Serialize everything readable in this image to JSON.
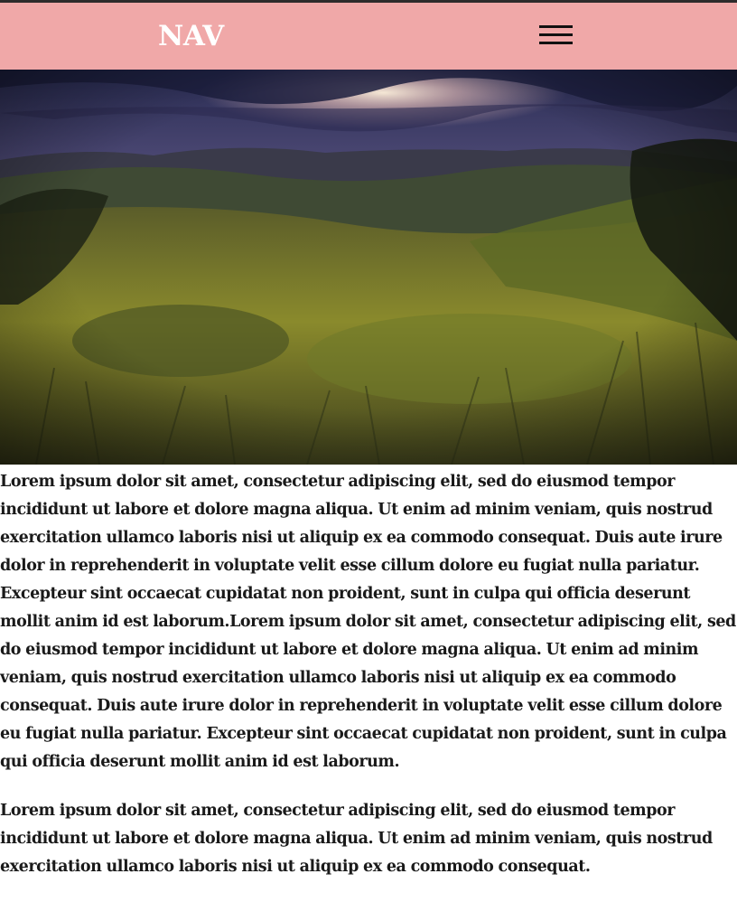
{
  "nav": {
    "logo_text": "NAV",
    "background_color": "#f0a8a8",
    "menu_icon": "hamburger-menu-icon"
  },
  "hero": {
    "image_description_icon": "landscape-sunset-photo"
  },
  "content": {
    "paragraphs": [
      "Lorem ipsum dolor sit amet, consectetur adipiscing elit, sed do eiusmod tempor incididunt ut labore et dolore magna aliqua. Ut enim ad minim veniam, quis nostrud exercitation ullamco laboris nisi ut aliquip ex ea commodo consequat. Duis aute irure dolor in reprehenderit in voluptate velit esse cillum dolore eu fugiat nulla pariatur. Excepteur sint occaecat cupidatat non proident, sunt in culpa qui officia deserunt mollit anim id est laborum.Lorem ipsum dolor sit amet, consectetur adipiscing elit, sed do eiusmod tempor incididunt ut labore et dolore magna aliqua. Ut enim ad minim veniam, quis nostrud exercitation ullamco laboris nisi ut aliquip ex ea commodo consequat. Duis aute irure dolor in reprehenderit in voluptate velit esse cillum dolore eu fugiat nulla pariatur. Excepteur sint occaecat cupidatat non proident, sunt in culpa qui officia deserunt mollit anim id est laborum.",
      "Lorem ipsum dolor sit amet, consectetur adipiscing elit, sed do eiusmod tempor incididunt ut labore et dolore magna aliqua. Ut enim ad minim veniam, quis nostrud exercitation ullamco laboris nisi ut aliquip ex ea commodo consequat."
    ]
  }
}
